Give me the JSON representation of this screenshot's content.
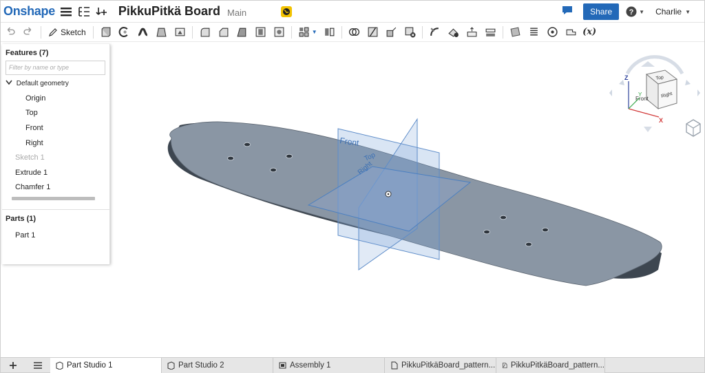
{
  "app": {
    "logo": "Onshape"
  },
  "document": {
    "title": "PikkuPitkä Board",
    "branch": "Main"
  },
  "header": {
    "share_label": "Share",
    "help_label": "?",
    "user_name": "Charlie"
  },
  "toolbar": {
    "sketch_label": "Sketch",
    "variables_label": "(x)"
  },
  "features": {
    "heading": "Features (7)",
    "filter_placeholder": "Filter by name or type",
    "default_geometry": "Default geometry",
    "items": [
      {
        "label": "Origin",
        "state": "normal"
      },
      {
        "label": "Top",
        "state": "normal"
      },
      {
        "label": "Front",
        "state": "normal"
      },
      {
        "label": "Right",
        "state": "normal"
      },
      {
        "label": "Sketch 1",
        "state": "dimmed"
      },
      {
        "label": "Extrude 1",
        "state": "normal"
      },
      {
        "label": "Chamfer 1",
        "state": "normal"
      }
    ]
  },
  "parts": {
    "heading": "Parts (1)",
    "items": [
      "Part 1"
    ]
  },
  "viewport": {
    "plane_labels": {
      "front": "Front",
      "top": "Top",
      "right": "Right"
    },
    "view_cube": {
      "top": "Top",
      "front": "Front",
      "right": "Right",
      "axis_x": "X",
      "axis_y": "Y",
      "axis_z": "Z"
    }
  },
  "tabs": [
    {
      "label": "Part Studio 1",
      "type": "part-studio",
      "active": true
    },
    {
      "label": "Part Studio 2",
      "type": "part-studio",
      "active": false
    },
    {
      "label": "Assembly 1",
      "type": "assembly",
      "active": false
    },
    {
      "label": "PikkuPitkäBoard_pattern...",
      "type": "file",
      "active": false
    },
    {
      "label": "PikkuPitkäBoard_pattern...",
      "type": "pdf",
      "active": false
    }
  ],
  "colors": {
    "brand": "#2369b8",
    "board": "#8a96a4",
    "board_edge": "#3d4650",
    "plane": "#4a7fc1"
  }
}
